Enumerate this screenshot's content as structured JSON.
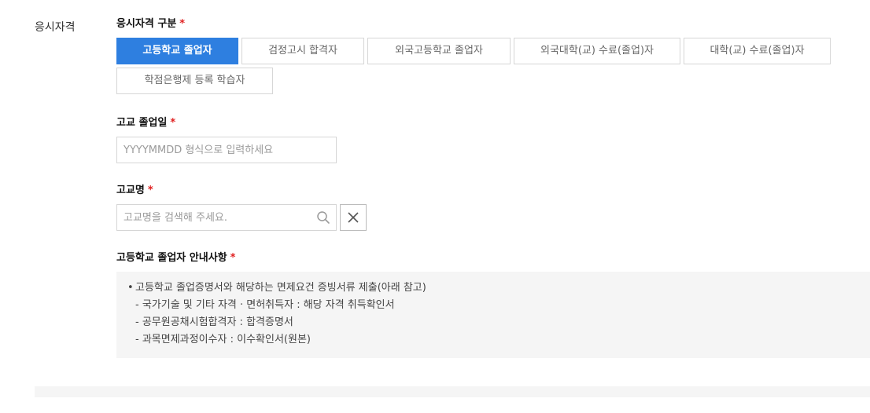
{
  "section_label": "응시자격",
  "qualification": {
    "label": "응시자격 구분",
    "required_mark": "*",
    "options": [
      {
        "label": "고등학교 졸업자",
        "active": true
      },
      {
        "label": "검정고시 합격자",
        "active": false
      },
      {
        "label": "외국고등학교 졸업자",
        "active": false
      },
      {
        "label": "외국대학(교) 수료(졸업)자",
        "active": false
      },
      {
        "label": "대학(교) 수료(졸업)자",
        "active": false
      },
      {
        "label": "학점은행제 등록 학습자",
        "active": false
      }
    ]
  },
  "graduation_date": {
    "label": "고교 졸업일",
    "required_mark": "*",
    "value": "",
    "placeholder": "YYYYMMDD 형식으로 입력하세요"
  },
  "school_name": {
    "label": "고교명",
    "required_mark": "*",
    "value": "",
    "placeholder": "고교명을 검색해 주세요.",
    "search_icon": "search-icon",
    "clear_icon": "close-icon"
  },
  "notice": {
    "label": "고등학교 졸업자 안내사항",
    "required_mark": "*",
    "bullet": "•",
    "lines": [
      "고등학교 졸업증명서와 해당하는 면제요건 증빙서류 제출(아래 참고)",
      "- 국가기술 및 기타 자격 · 면허취득자 : 해당 자격 취득확인서",
      "- 공무원공채시험합격자 : 합격증명서",
      "- 과목면제과정이수자 : 이수확인서(원본)"
    ]
  },
  "colors": {
    "accent": "#2e7fe0",
    "required": "#e02020",
    "notice_bg": "#f5f5f5"
  }
}
